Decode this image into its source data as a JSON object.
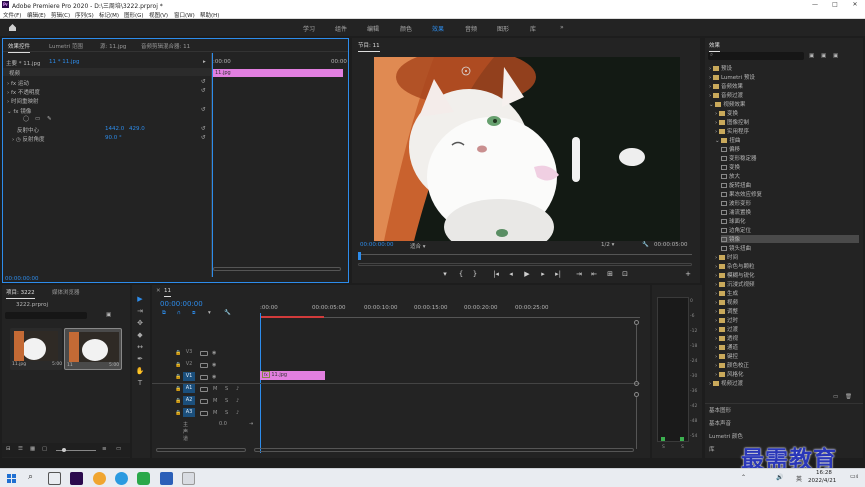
{
  "app": {
    "title": "Adobe Premiere Pro 2020 - D:\\三周培\\3222.prproj *",
    "logo": "Pr",
    "window_controls": [
      "—",
      "□",
      "✕"
    ]
  },
  "menu": [
    "文件(F)",
    "编辑(E)",
    "剪辑(C)",
    "序列(S)",
    "标记(M)",
    "图形(G)",
    "视图(V)",
    "窗口(W)",
    "帮助(H)"
  ],
  "workspaces": {
    "home_icon": "home-icon",
    "items": [
      "学习",
      "组件",
      "编辑",
      "颜色",
      "效果",
      "音频",
      "图形",
      "库"
    ],
    "active": "效果",
    "more": "»"
  },
  "effect_controls": {
    "tabs": [
      "效果控件",
      "Lumetri 范围",
      "源: 11.jpg",
      "音频剪辑混合器: 11"
    ],
    "source": "主要 * 11.jpg",
    "clip": "11 * 11.jpg",
    "video_header": "视频",
    "timecode_start": ":00:00",
    "timecode_end": "00:00",
    "clip_label": "11.jpg",
    "rows": [
      "运动",
      "不透明度",
      "时间重映射",
      "镜像"
    ],
    "fx_prefix": "fx",
    "reflection_center_label": "反射中心",
    "reflection_center_x": "1442.0",
    "reflection_center_y": "429.0",
    "reflection_angle_label": "反射角度",
    "reflection_angle_value": "90.0 °",
    "bottom_time": "00:00:00:00"
  },
  "program_monitor": {
    "tab": "节目: 11",
    "timecode": "00:00:00:00",
    "fit": "适合",
    "resolution": "1/2",
    "duration": "00:00:05:00",
    "controls": [
      "▾",
      "{",
      "}",
      "|◂",
      "◂|",
      "◂",
      "▶",
      "▸",
      "|▸",
      "▸|",
      "⇥",
      "⇤",
      "⊞",
      "⊡",
      "+"
    ]
  },
  "project": {
    "tabs": [
      "项目: 3222",
      "媒体浏览器"
    ],
    "filename": "3222.prproj",
    "items": [
      {
        "name": "11.jpg",
        "duration": "5:00"
      },
      {
        "name": "11",
        "duration": "5:00"
      }
    ]
  },
  "timeline": {
    "tab": "11",
    "timecode": "00:00:00:00",
    "ruler": [
      ":00:00",
      "00:00:05:00",
      "00:00:10:00",
      "00:00:15:00",
      "00:00:20:00",
      "00:00:25:00"
    ],
    "video_tracks": [
      "V3",
      "V2",
      "V1"
    ],
    "audio_tracks": [
      "A1",
      "A2",
      "A3"
    ],
    "master_label": "主声道",
    "master_value": "0.0",
    "clip_label": "11.jpg",
    "fx_badge": "fx",
    "track_button_labels": {
      "mute": "M",
      "solo": "S"
    }
  },
  "audio_meter": {
    "scale": [
      "0",
      "-6",
      "-12",
      "-18",
      "-24",
      "-30",
      "-36",
      "-42",
      "-48",
      "-54"
    ],
    "footer": [
      "S",
      "S"
    ]
  },
  "effects_panel": {
    "title": "效果",
    "tree": [
      {
        "label": "预设",
        "level": 0,
        "open": false
      },
      {
        "label": "Lumetri 预设",
        "level": 0,
        "open": false
      },
      {
        "label": "音频效果",
        "level": 0,
        "open": false
      },
      {
        "label": "音频过渡",
        "level": 0,
        "open": false
      },
      {
        "label": "视频效果",
        "level": 0,
        "open": true
      },
      {
        "label": "变换",
        "level": 1,
        "open": false
      },
      {
        "label": "图像控制",
        "level": 1,
        "open": false
      },
      {
        "label": "实用程序",
        "level": 1,
        "open": false
      },
      {
        "label": "扭曲",
        "level": 1,
        "open": true
      },
      {
        "label": "偏移",
        "level": 2,
        "fx": true
      },
      {
        "label": "变形稳定器",
        "level": 2,
        "fx": true
      },
      {
        "label": "变换",
        "level": 2,
        "fx": true
      },
      {
        "label": "放大",
        "level": 2,
        "fx": true
      },
      {
        "label": "旋转扭曲",
        "level": 2,
        "fx": true
      },
      {
        "label": "果冻效应修复",
        "level": 2,
        "fx": true
      },
      {
        "label": "波形变形",
        "level": 2,
        "fx": true
      },
      {
        "label": "湍流置换",
        "level": 2,
        "fx": true
      },
      {
        "label": "球面化",
        "level": 2,
        "fx": true
      },
      {
        "label": "边角定位",
        "level": 2,
        "fx": true
      },
      {
        "label": "镜像",
        "level": 2,
        "fx": true,
        "selected": true
      },
      {
        "label": "镜头扭曲",
        "level": 2,
        "fx": true
      },
      {
        "label": "时间",
        "level": 1,
        "open": false
      },
      {
        "label": "杂色与颗粒",
        "level": 1,
        "open": false
      },
      {
        "label": "模糊与锐化",
        "level": 1,
        "open": false
      },
      {
        "label": "沉浸式视频",
        "level": 1,
        "open": false
      },
      {
        "label": "生成",
        "level": 1,
        "open": false
      },
      {
        "label": "视频",
        "level": 1,
        "open": false
      },
      {
        "label": "调整",
        "level": 1,
        "open": false
      },
      {
        "label": "过时",
        "level": 1,
        "open": false
      },
      {
        "label": "过渡",
        "level": 1,
        "open": false
      },
      {
        "label": "透视",
        "level": 1,
        "open": false
      },
      {
        "label": "通道",
        "level": 1,
        "open": false
      },
      {
        "label": "键控",
        "level": 1,
        "open": false
      },
      {
        "label": "颜色校正",
        "level": 1,
        "open": false
      },
      {
        "label": "风格化",
        "level": 1,
        "open": false
      },
      {
        "label": "视频过渡",
        "level": 0,
        "open": false
      }
    ],
    "sections": [
      "基本图形",
      "基本声音",
      "Lumetri 颜色",
      "库"
    ]
  },
  "watermark": "最需教育",
  "taskbar": {
    "time": "16:28",
    "date": "2022/4/21",
    "ime": "英",
    "notif_count": "4"
  }
}
